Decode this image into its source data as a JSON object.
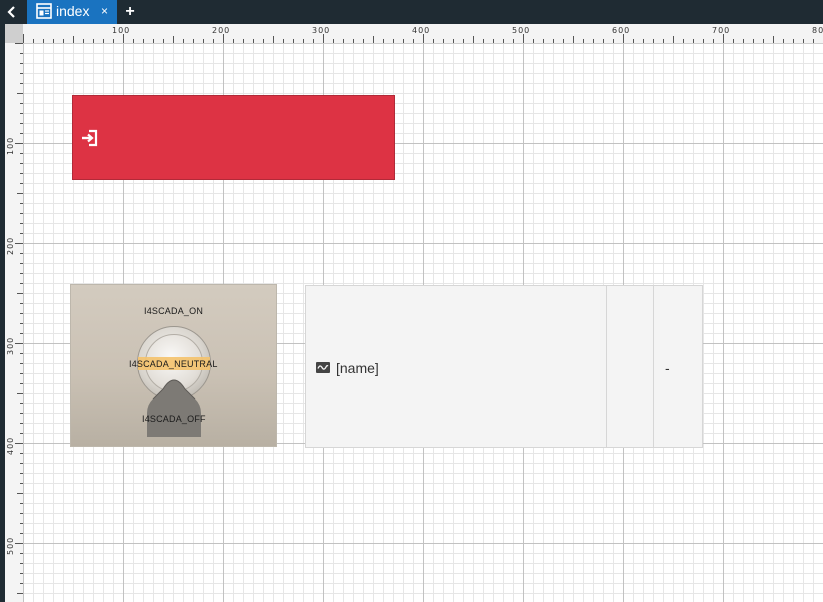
{
  "tabbar": {
    "active_tab": {
      "label": "index",
      "close_label": "×"
    },
    "add_label": "+",
    "back_icon": "chevron-left-icon",
    "tab_icon": "page-layout-icon"
  },
  "rulers": {
    "top_labels": [
      "100",
      "200",
      "300",
      "400",
      "500",
      "600",
      "700",
      "80"
    ],
    "left_labels": [
      "100",
      "200",
      "300",
      "400",
      "500"
    ]
  },
  "login_widget": {
    "icon": "sign-in-icon",
    "color": "#dd3344"
  },
  "switch_widget": {
    "label_on": "I4SCADA_ON",
    "label_neutral": "I4SCADA_NEUTRAL",
    "label_off": "I4SCADA_OFF",
    "highlight_color": "#f4c26b"
  },
  "signal_widget": {
    "icon": "signal-wave-icon",
    "name": "[name]",
    "unit": "",
    "value": "-"
  }
}
